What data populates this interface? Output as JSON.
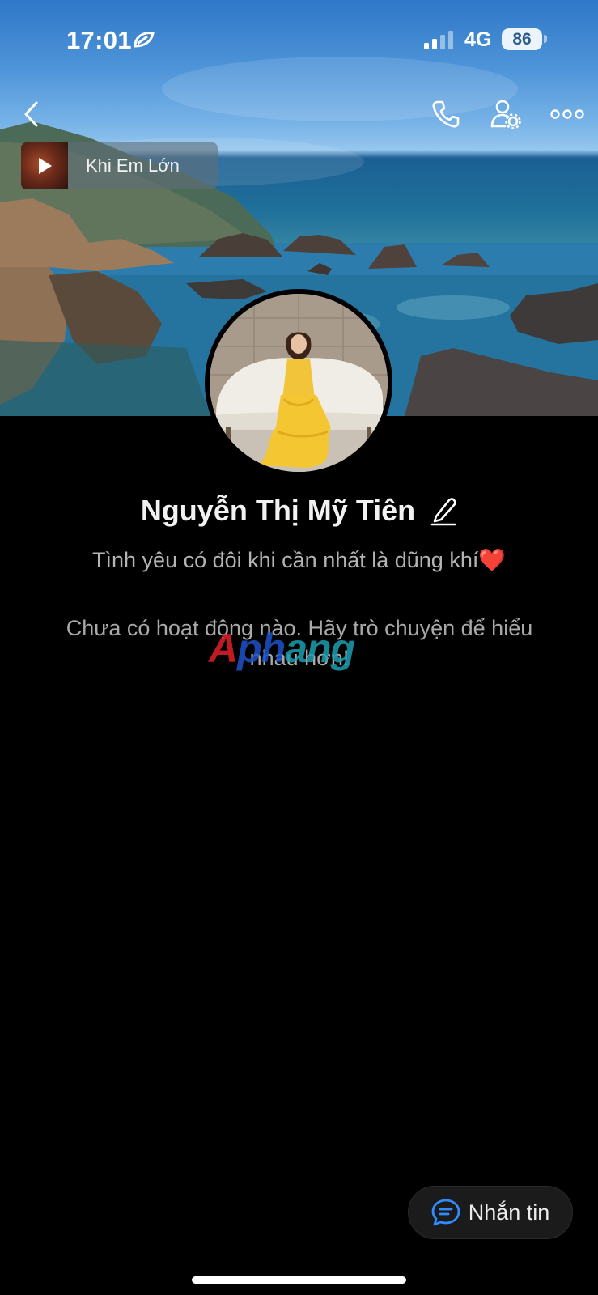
{
  "status_bar": {
    "time": "17:01",
    "network": "4G",
    "battery": "86"
  },
  "nav": {
    "back_icon": "chevron-left-icon",
    "call_icon": "phone-icon",
    "settings_icon": "user-settings-icon",
    "more_icon": "more-dots-icon"
  },
  "music": {
    "title": "Khi Em Lớn"
  },
  "profile": {
    "name": "Nguyễn Thị Mỹ Tiên",
    "bio": "Tình yêu có đôi khi cần nhất là dũng khí",
    "bio_emoji": "❤️"
  },
  "feed": {
    "empty_text": "Chưa có hoạt động nào. Hãy trò chuyện để hiểu nhau hơn!"
  },
  "watermark": {
    "part1": "A",
    "part2": "ph",
    "part3": "ang"
  },
  "actions": {
    "message_label": "Nhắn tin"
  },
  "colors": {
    "background": "#000000",
    "accent": "#2f8dff"
  }
}
